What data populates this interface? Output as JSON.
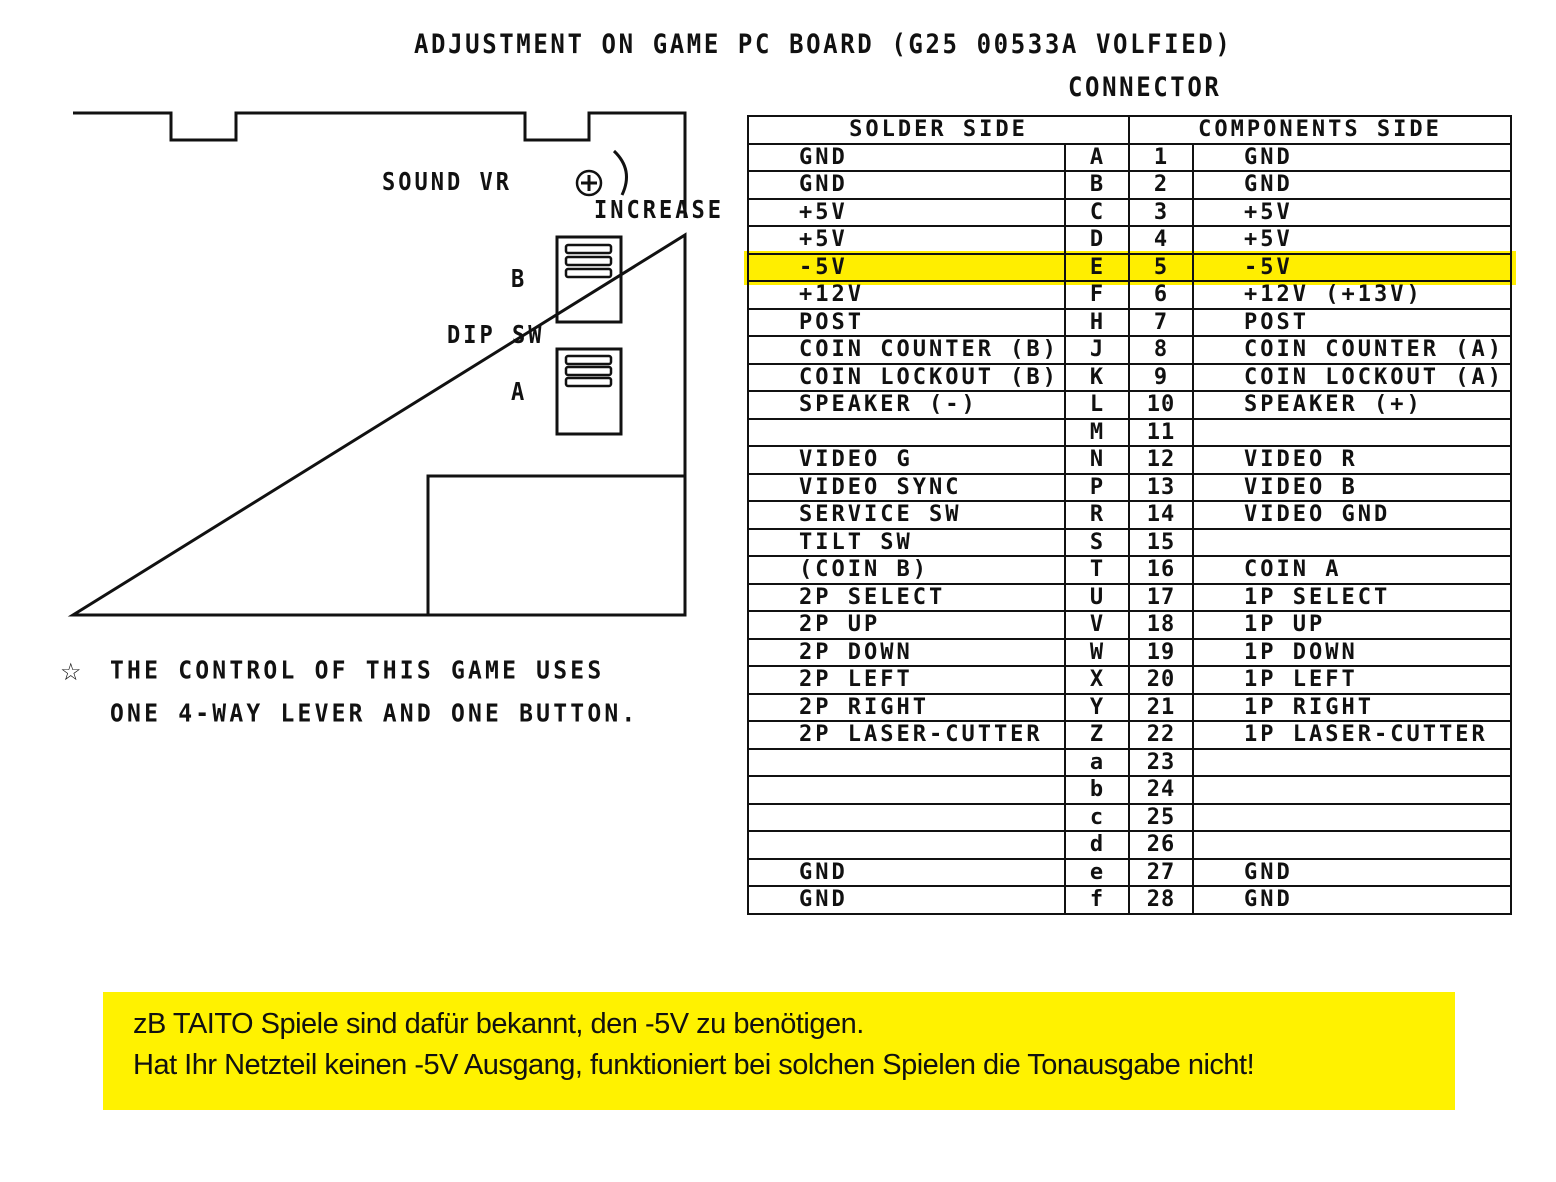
{
  "title": "ADJUSTMENT ON GAME PC BOARD (G25 00533A VOLFIED)",
  "connector_label": "CONNECTOR",
  "board": {
    "sound_vr_label": "SOUND VR",
    "increase_label": "INCREASE",
    "dip_sw_label": "DIP SW",
    "dip_b_label": "B",
    "dip_a_label": "A",
    "potentiometer_icon": "circle-plus-icon"
  },
  "table": {
    "header_solder": "SOLDER SIDE",
    "header_components": "COMPONENTS SIDE",
    "highlight_color": "#ffee00",
    "highlighted_pin": "E/5",
    "rows": [
      {
        "solder": "GND",
        "letter": "A",
        "num": "1",
        "components": "GND"
      },
      {
        "solder": "GND",
        "letter": "B",
        "num": "2",
        "components": "GND"
      },
      {
        "solder": "+5V",
        "letter": "C",
        "num": "3",
        "components": "+5V"
      },
      {
        "solder": "+5V",
        "letter": "D",
        "num": "4",
        "components": "+5V"
      },
      {
        "solder": "-5V",
        "letter": "E",
        "num": "5",
        "components": "-5V",
        "highlight": true
      },
      {
        "solder": "+12V",
        "letter": "F",
        "num": "6",
        "components": "+12V  (+13V)"
      },
      {
        "solder": "POST",
        "letter": "H",
        "num": "7",
        "components": "POST"
      },
      {
        "solder": "COIN COUNTER (B)",
        "letter": "J",
        "num": "8",
        "components": "COIN COUNTER (A)"
      },
      {
        "solder": "COIN LOCKOUT (B)",
        "letter": "K",
        "num": "9",
        "components": "COIN LOCKOUT (A)"
      },
      {
        "solder": "SPEAKER (-)",
        "letter": "L",
        "num": "10",
        "components": "SPEAKER (+)"
      },
      {
        "solder": "",
        "letter": "M",
        "num": "11",
        "components": ""
      },
      {
        "solder": "VIDEO G",
        "letter": "N",
        "num": "12",
        "components": "VIDEO R"
      },
      {
        "solder": "VIDEO SYNC",
        "letter": "P",
        "num": "13",
        "components": "VIDEO B"
      },
      {
        "solder": "SERVICE SW",
        "letter": "R",
        "num": "14",
        "components": "VIDEO GND"
      },
      {
        "solder": "TILT SW",
        "letter": "S",
        "num": "15",
        "components": ""
      },
      {
        "solder": "(COIN B)",
        "letter": "T",
        "num": "16",
        "components": "COIN A"
      },
      {
        "solder": "2P SELECT",
        "letter": "U",
        "num": "17",
        "components": "1P SELECT"
      },
      {
        "solder": "2P UP",
        "letter": "V",
        "num": "18",
        "components": "1P UP"
      },
      {
        "solder": "2P DOWN",
        "letter": "W",
        "num": "19",
        "components": "1P DOWN"
      },
      {
        "solder": "2P LEFT",
        "letter": "X",
        "num": "20",
        "components": "1P LEFT"
      },
      {
        "solder": "2P RIGHT",
        "letter": "Y",
        "num": "21",
        "components": "1P RIGHT"
      },
      {
        "solder": "2P LASER-CUTTER",
        "letter": "Z",
        "num": "22",
        "components": "1P LASER-CUTTER"
      },
      {
        "solder": "",
        "letter": "a",
        "num": "23",
        "components": ""
      },
      {
        "solder": "",
        "letter": "b",
        "num": "24",
        "components": ""
      },
      {
        "solder": "",
        "letter": "c",
        "num": "25",
        "components": ""
      },
      {
        "solder": "",
        "letter": "d",
        "num": "26",
        "components": ""
      },
      {
        "solder": "GND",
        "letter": "e",
        "num": "27",
        "components": "GND"
      },
      {
        "solder": "GND",
        "letter": "f",
        "num": "28",
        "components": "GND"
      }
    ]
  },
  "note": {
    "icon": "star-outline-icon",
    "star_glyph": "☆",
    "line1": "THE CONTROL OF THIS GAME USES",
    "line2": "ONE 4-WAY LEVER AND ONE BUTTON."
  },
  "callout": {
    "background": "#fff200",
    "line1": "zB TAITO Spiele sind dafür bekannt, den -5V zu benötigen.",
    "line2": "Hat Ihr Netzteil keinen -5V Ausgang, funktioniert bei solchen Spielen die Tonausgabe nicht!"
  }
}
